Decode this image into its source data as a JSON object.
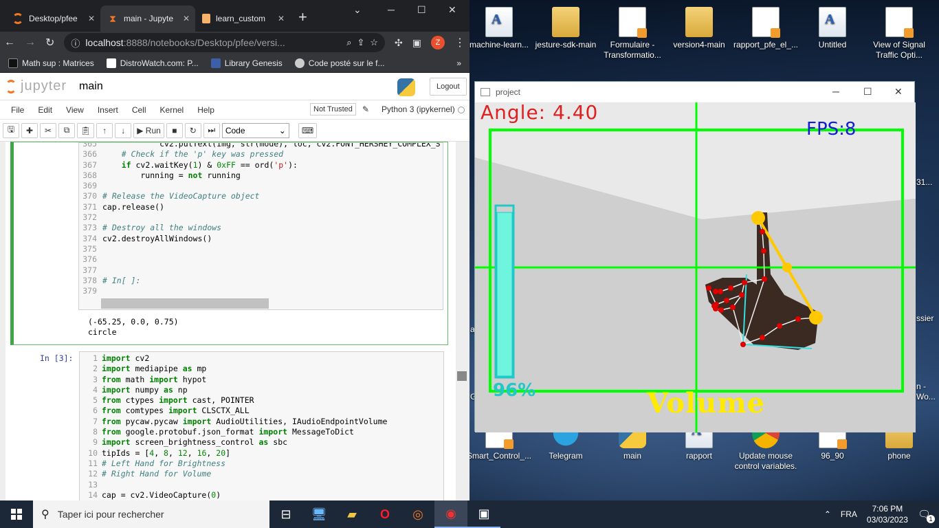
{
  "browser": {
    "tabs": [
      {
        "label": "Desktop/pfee",
        "color": "#f37626"
      },
      {
        "label": "main - Jupyte",
        "color": "#f37626"
      },
      {
        "label": "learn_custom",
        "color": "#f6b26b"
      }
    ],
    "profile_initial": "Z",
    "url_host": "localhost",
    "url_path": ":8888/notebooks/Desktop/pfee/versi...",
    "bookmarks": [
      "Math sup : Matrices",
      "DistroWatch.com: P...",
      "Library Genesis",
      "Code posté sur le f..."
    ]
  },
  "jupyter": {
    "logo_text": "jupyter",
    "notebook_name": "main",
    "logout_label": "Logout",
    "menu": [
      "File",
      "Edit",
      "View",
      "Insert",
      "Cell",
      "Kernel",
      "Help"
    ],
    "trust": "Not Trusted",
    "kernel": "Python 3 (ipykernel)",
    "run_label": "Run",
    "cell_type": "Code"
  },
  "cell1": {
    "line_numbers": [
      "365",
      "366",
      "367",
      "368",
      "369",
      "370",
      "371",
      "372",
      "373",
      "374",
      "375",
      "376",
      "377",
      "378",
      "379"
    ],
    "lines": [
      "            cv2.putText(img, str(mode), loc, cv2.FONT_HERSHEY_COMPLEX_S",
      "    # Check if the 'p' key was pressed",
      "    if cv2.waitKey(1) & 0xFF == ord('p'):",
      "        running = not running",
      "",
      "# Release the VideoCapture object",
      "cap.release()",
      "",
      "# Destroy all the windows",
      "cv2.destroyAllWindows()",
      "",
      "",
      "",
      "# In[ ]:",
      ""
    ],
    "output": [
      "(-65.25, 0.0, 0.75)",
      "circle"
    ]
  },
  "cell2": {
    "prompt": "In [3]:",
    "line_numbers": [
      "1",
      "2",
      "3",
      "4",
      "5",
      "6",
      "7",
      "8",
      "9",
      "10",
      "11",
      "12",
      "13",
      "14"
    ],
    "lines": [
      "import cv2",
      "import mediapipe as mp",
      "from math import hypot",
      "import numpy as np",
      "from ctypes import cast, POINTER",
      "from comtypes import CLSCTX_ALL",
      "from pycaw.pycaw import AudioUtilities, IAudioEndpointVolume",
      "from google.protobuf.json_format import MessageToDict",
      "import screen_brightness_control as sbc",
      "tipIds = [4, 8, 12, 16, 20]",
      "# Left Hand for Brightness",
      "# Right Hand for Volume",
      "",
      "cap = cv2.VideoCapture(0)"
    ]
  },
  "desktop": {
    "top_icons": [
      {
        "label": "machine-learn...",
        "type": "doc"
      },
      {
        "label": "jesture-sdk-main",
        "type": "folder"
      },
      {
        "label": "Formulaire - Transformatio...",
        "type": "pdf"
      },
      {
        "label": "version4-main",
        "type": "folder"
      },
      {
        "label": "rapport_pfe_el_...",
        "type": "pdf"
      },
      {
        "label": "Untitled",
        "type": "doc"
      },
      {
        "label": "View of Signal Traffic Opti...",
        "type": "pdf"
      }
    ],
    "bottom_icons": [
      {
        "label": "Smart_Control_...",
        "type": "pdf"
      },
      {
        "label": "Telegram",
        "type": "telegram"
      },
      {
        "label": "main",
        "type": "python"
      },
      {
        "label": "rapport",
        "type": "word"
      },
      {
        "label": "Update mouse control variables.",
        "type": "chrome"
      },
      {
        "label": "96_90",
        "type": "pdf"
      },
      {
        "label": "phone",
        "type": "folder"
      }
    ],
    "partial_labels": [
      "31...",
      "ssier",
      "n -",
      "Wo...",
      "G",
      "a"
    ]
  },
  "project_window": {
    "title": "project",
    "angle_text": "Angle: 4.40",
    "fps_text": "FPS:8",
    "volume_percent_text": "96%",
    "volume_fraction": 0.96,
    "mode_text": "Volume",
    "colors": {
      "grid": "#00ff00",
      "angle": "#e02020",
      "fps": "#1020d0",
      "bar": "#6ff5de",
      "bar_border": "#20c8c8",
      "mode": "#ffea00",
      "line": "#ffc800",
      "landmark": "#e00000"
    }
  },
  "taskbar": {
    "search_placeholder": "Taper ici pour rechercher",
    "lang": "FRA",
    "time": "7:06 PM",
    "date": "03/03/2023",
    "notification_count": "1"
  }
}
